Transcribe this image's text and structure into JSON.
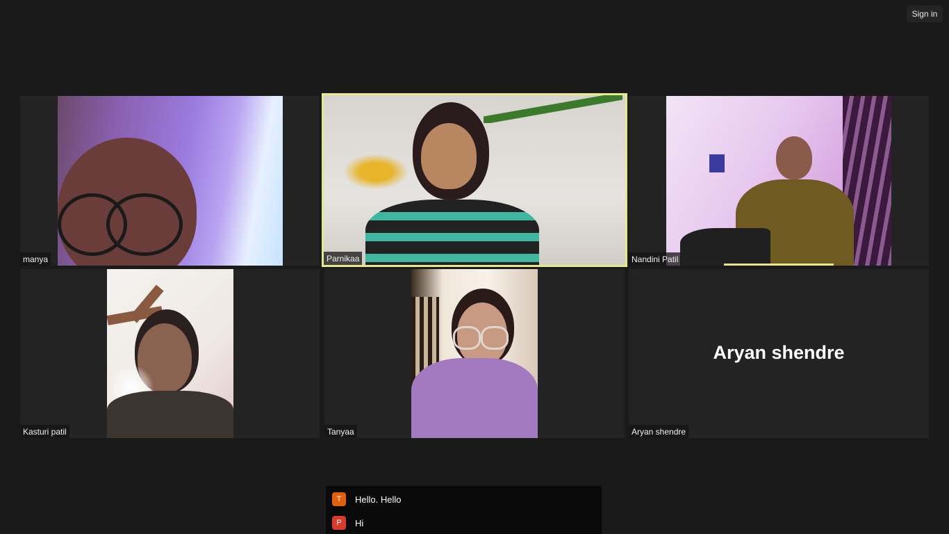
{
  "header": {
    "signin_label": "Sign in"
  },
  "participants": [
    {
      "name": "manya"
    },
    {
      "name": "Parnikaa"
    },
    {
      "name": "Nandini Patil"
    },
    {
      "name": "Kasturi patil"
    },
    {
      "name": "Tanyaa"
    },
    {
      "name": "Aryan shendre",
      "display_name": "Aryan shendre"
    }
  ],
  "chat": {
    "messages": [
      {
        "initial": "T",
        "text": "Hello. Hello",
        "avatar_color": "#e0600f"
      },
      {
        "initial": "P",
        "text": "Hi",
        "avatar_color": "#d93a2b"
      }
    ]
  },
  "colors": {
    "active_speaker_border": "#e6e88f",
    "background": "#1a1a1a",
    "tile_background": "#232323"
  }
}
